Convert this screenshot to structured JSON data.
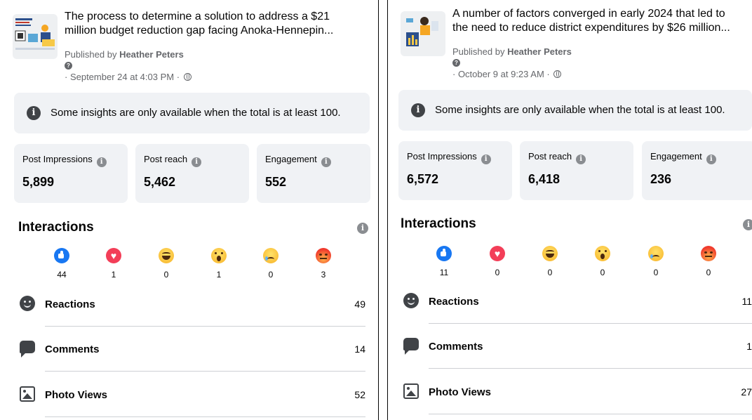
{
  "posts": [
    {
      "title_line1": "The process to determine a solution to address a $21",
      "title_line2": "million budget reduction gap facing Anoka-Hennepin...",
      "published_prefix": "Published by ",
      "author": "Heather Peters",
      "date": "· September 24 at 4:03 PM ·",
      "notice": "Some insights are only available when the total is at least 100.",
      "metrics": [
        {
          "label": "Post Impressions",
          "value": "5,899"
        },
        {
          "label": "Post reach",
          "value": "5,462"
        },
        {
          "label": "Engagement",
          "value": "552"
        }
      ],
      "interactions_title": "Interactions",
      "reactions": [
        {
          "type": "like",
          "count": "44"
        },
        {
          "type": "love",
          "count": "1"
        },
        {
          "type": "haha",
          "count": "0"
        },
        {
          "type": "wow",
          "count": "1"
        },
        {
          "type": "sad",
          "count": "0"
        },
        {
          "type": "angry",
          "count": "3"
        }
      ],
      "stats": [
        {
          "label": "Reactions",
          "value": "49",
          "icon": "smile-icon"
        },
        {
          "label": "Comments",
          "value": "14",
          "icon": "comment-icon"
        },
        {
          "label": "Photo Views",
          "value": "52",
          "icon": "photo-icon"
        }
      ]
    },
    {
      "title_line1": "A number of factors converged in early 2024 that led to",
      "title_line2": "the need to reduce district expenditures by $26 million...",
      "published_prefix": "Published by ",
      "author": "Heather Peters",
      "date": "· October 9 at 9:23 AM ·",
      "notice": "Some insights are only available when the total is at least 100.",
      "metrics": [
        {
          "label": "Post Impressions",
          "value": "6,572"
        },
        {
          "label": "Post reach",
          "value": "6,418"
        },
        {
          "label": "Engagement",
          "value": "236"
        }
      ],
      "interactions_title": "Interactions",
      "reactions": [
        {
          "type": "like",
          "count": "11"
        },
        {
          "type": "love",
          "count": "0"
        },
        {
          "type": "haha",
          "count": "0"
        },
        {
          "type": "wow",
          "count": "0"
        },
        {
          "type": "sad",
          "count": "0"
        },
        {
          "type": "angry",
          "count": "0"
        }
      ],
      "stats": [
        {
          "label": "Reactions",
          "value": "11",
          "icon": "smile-icon"
        },
        {
          "label": "Comments",
          "value": "1",
          "icon": "comment-icon"
        },
        {
          "label": "Photo Views",
          "value": "27",
          "icon": "photo-icon"
        }
      ]
    }
  ],
  "colors": {
    "like": "#1877f2",
    "love": "#f33e58",
    "card_bg": "#f0f2f5",
    "text": "#050505",
    "muted": "#65676b"
  }
}
